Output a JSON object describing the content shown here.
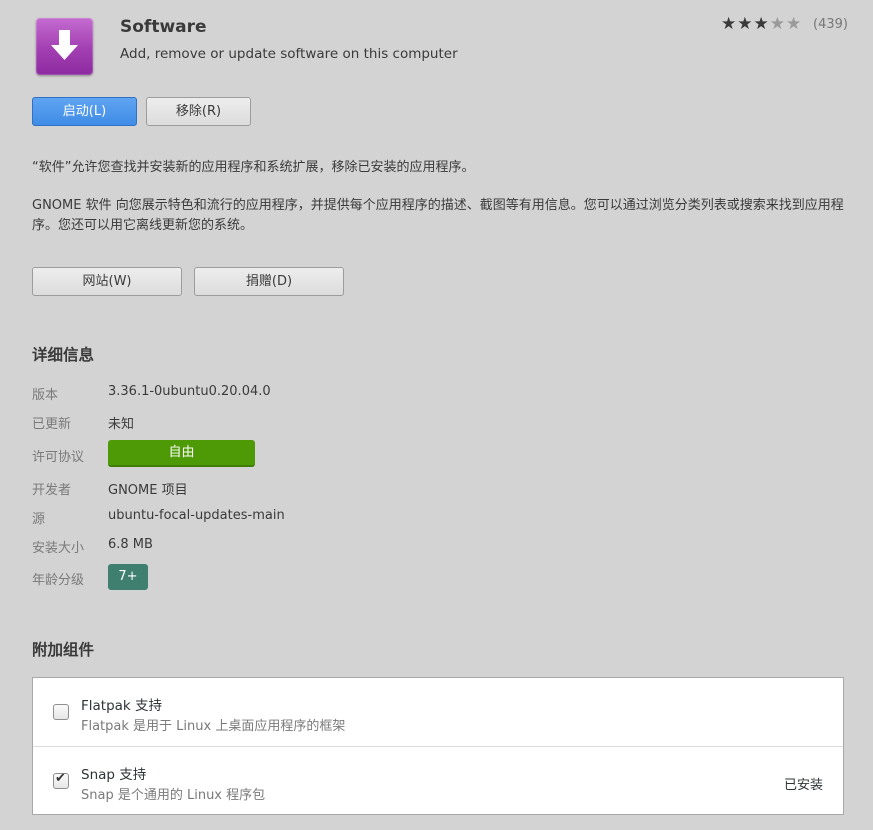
{
  "app": {
    "name": "Software",
    "summary": "Add, remove or update software on this computer",
    "icon": "download-arrow-icon",
    "rating": {
      "stars_filled": 3,
      "stars_total": 5,
      "count": "(439)"
    }
  },
  "actions": {
    "launch": "启动(L)",
    "remove": "移除(R)"
  },
  "description": {
    "p1": "“软件”允许您查找并安装新的应用程序和系统扩展，移除已安装的应用程序。",
    "p2_line1": "GNOME 软件 向您展示特色和流行的应用程序，并提供每个应用程序的描述、截图等有用信息。您可以通过浏览分类列表或搜索来找到应用程",
    "p2_line2": "序。您还可以用它离线更新您的系统。"
  },
  "links": {
    "website": "网站(W)",
    "donate": "捐赠(D)"
  },
  "details": {
    "heading": "详细信息",
    "version_label": "版本",
    "version_value": "3.36.1-0ubuntu0.20.04.0",
    "updated_label": "已更新",
    "updated_value": "未知",
    "license_label": "许可协议",
    "license_value": "自由",
    "developer_label": "开发者",
    "developer_value": "GNOME 项目",
    "source_label": "源",
    "source_value": "ubuntu-focal-updates-main",
    "size_label": "安装大小",
    "size_value": "6.8 MB",
    "age_label": "年龄分级",
    "age_value": "7+"
  },
  "addons": {
    "heading": "附加组件",
    "items": [
      {
        "name": "Flatpak 支持",
        "description": "Flatpak 是用于 Linux 上桌面应用程序的框架",
        "checked": false,
        "status": ""
      },
      {
        "name": "Snap 支持",
        "description": "Snap 是个通用的 Linux 程序包",
        "checked": true,
        "status": "已安装"
      }
    ]
  },
  "colors": {
    "background": "#d3d3d3",
    "primary": "#3f8ce6",
    "license_badge": "#4e9a06",
    "age_badge": "#3f7f70"
  }
}
